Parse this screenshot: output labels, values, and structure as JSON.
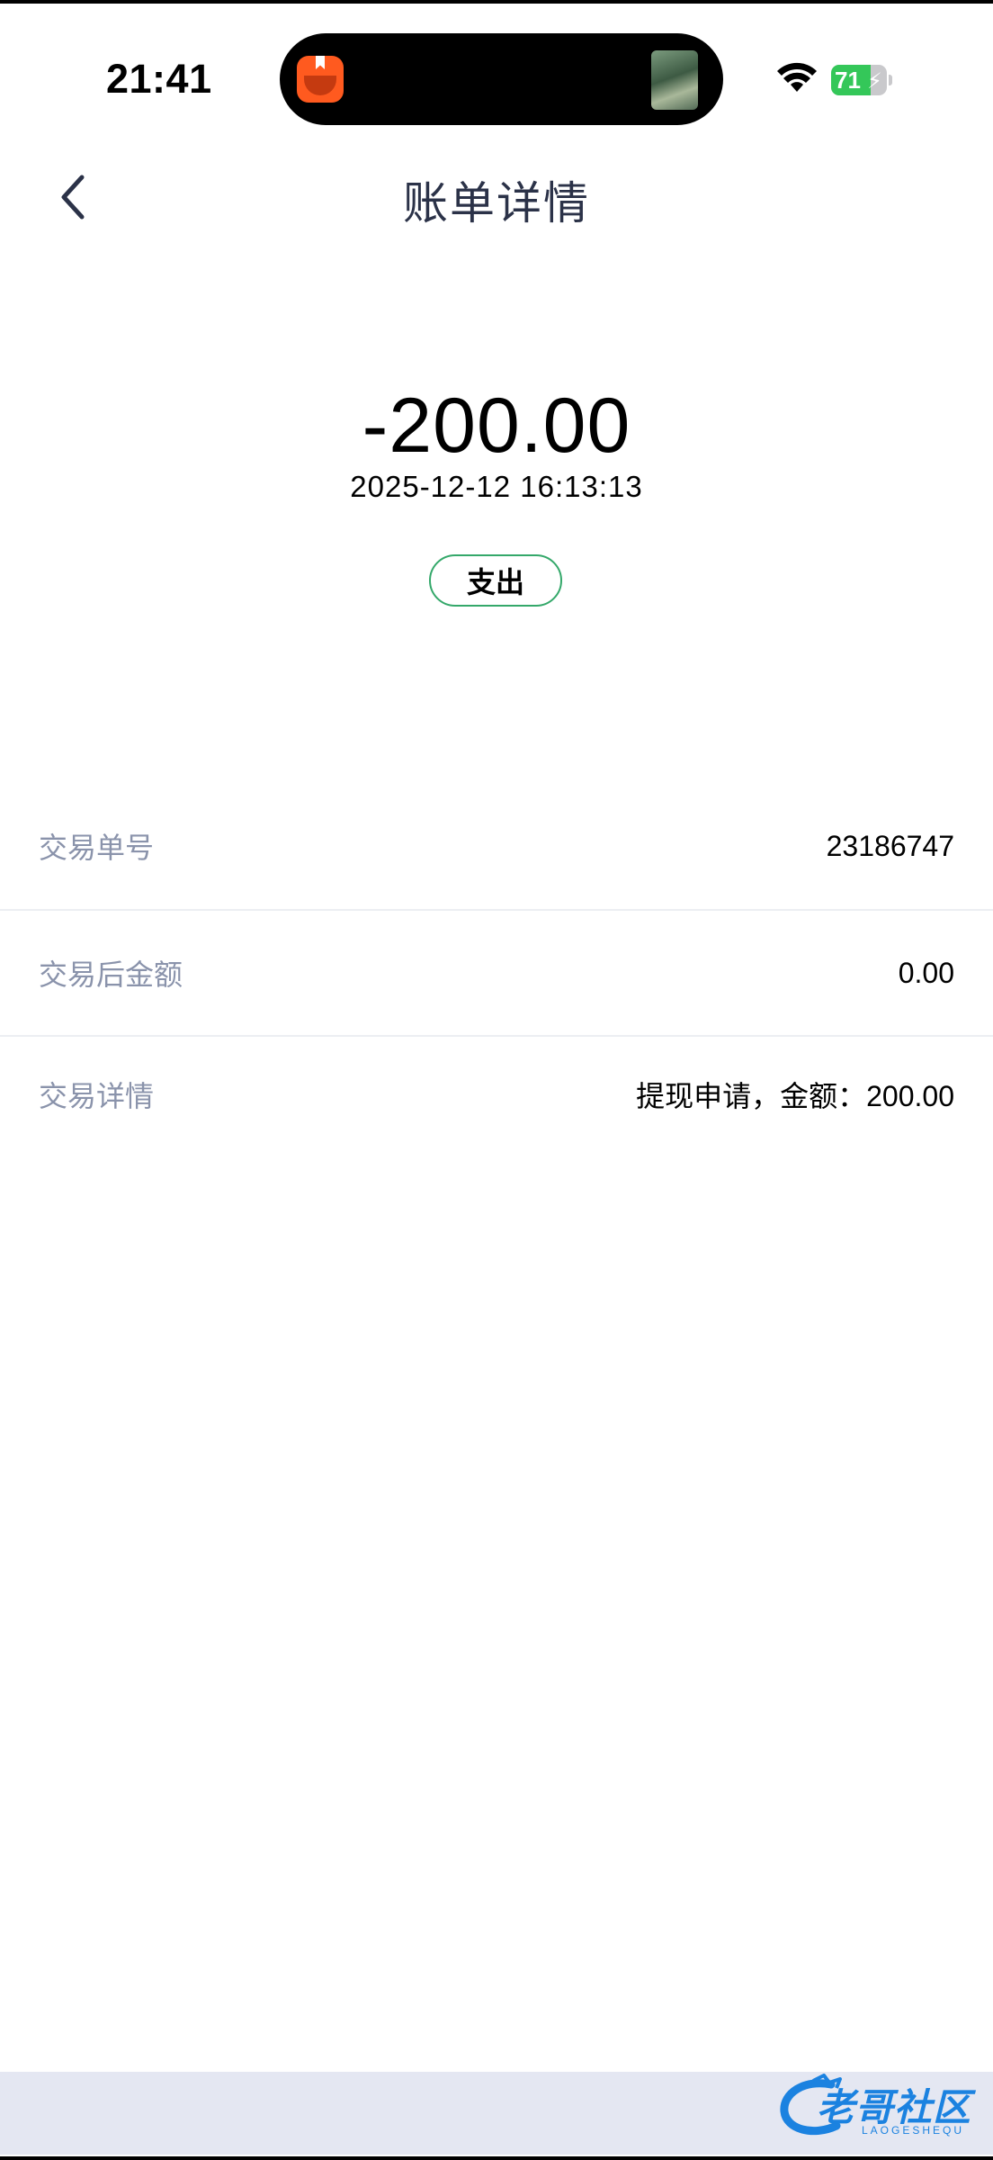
{
  "status_bar": {
    "time": "21:41",
    "battery_level": "71",
    "battery_percent": 71
  },
  "nav": {
    "title": "账单详情"
  },
  "transaction": {
    "amount": "-200.00",
    "datetime": "2025-12-12 16:13:13",
    "type_label": "支出"
  },
  "details": [
    {
      "label": "交易单号",
      "value": "23186747"
    },
    {
      "label": "交易后金额",
      "value": "0.00"
    },
    {
      "label": "交易详情",
      "value": "提现申请，金额：200.00"
    }
  ],
  "watermark": {
    "text": "老哥社区",
    "subtext": "LAOGESHEQU"
  },
  "colors": {
    "badge_border": "#34a86a",
    "label_gray": "#8a93ab",
    "battery_green": "#34c759",
    "watermark_blue": "#1b82e0",
    "nav_title": "#2b3248"
  },
  "icons": {
    "back": "chevron-left-icon",
    "wifi": "wifi-icon",
    "battery": "battery-icon",
    "charging": "bolt-icon",
    "app": "reader-app-icon"
  }
}
